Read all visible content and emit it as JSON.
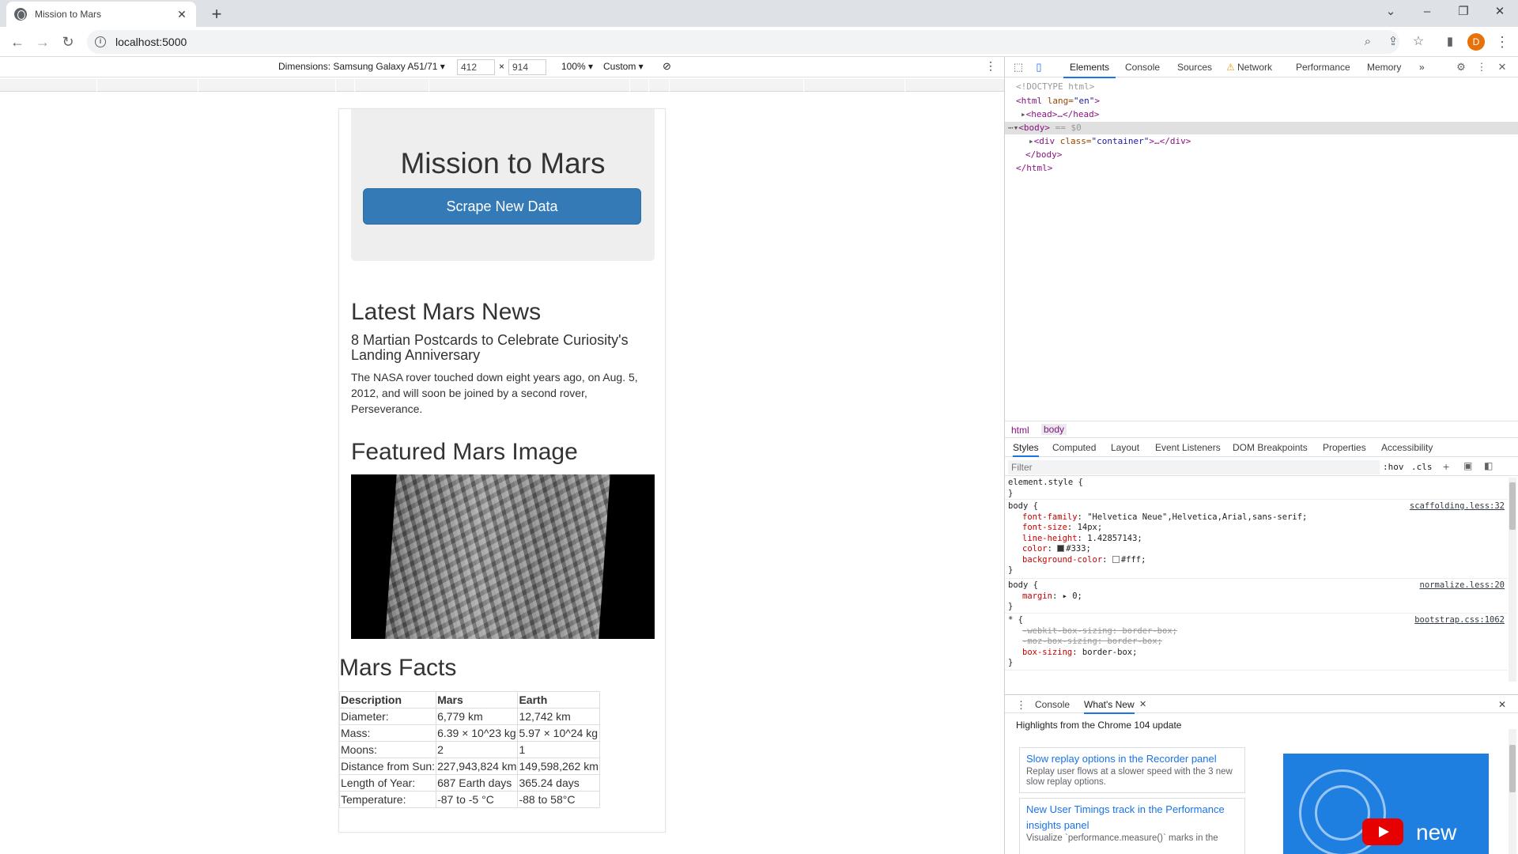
{
  "browser": {
    "tab_title": "Mission to Mars",
    "tab_close": "✕",
    "new_tab": "+",
    "url": "localhost:5000",
    "avatar_initial": "D"
  },
  "device_toolbar": {
    "dimensions_label": "Dimensions: Samsung Galaxy A51/71 ▾",
    "width": "412",
    "times": "×",
    "height": "914",
    "zoom": "100% ▾",
    "throttle": "Custom ▾"
  },
  "page": {
    "title": "Mission to Mars",
    "scrape_button": "Scrape New Data",
    "news_heading": "Latest Mars News",
    "news_title": "8 Martian Postcards to Celebrate Curiosity's Landing Anniversary",
    "news_paragraph": "The NASA rover touched down eight years ago, on Aug. 5, 2012, and will soon be joined by a second rover, Perseverance.",
    "image_heading": "Featured Mars Image",
    "facts_heading": "Mars Facts",
    "facts_table": {
      "headers": [
        "Description",
        "Mars",
        "Earth"
      ],
      "rows": [
        [
          "Diameter:",
          "6,779 km",
          "12,742 km"
        ],
        [
          "Mass:",
          "6.39 × 10^23 kg",
          "5.97 × 10^24 kg"
        ],
        [
          "Moons:",
          "2",
          "1"
        ],
        [
          "Distance from Sun:",
          "227,943,824 km",
          "149,598,262 km"
        ],
        [
          "Length of Year:",
          "687 Earth days",
          "365.24 days"
        ],
        [
          "Temperature:",
          "-87 to -5 °C",
          "-88 to 58°C"
        ]
      ]
    }
  },
  "devtools": {
    "tabs": [
      "Elements",
      "Console",
      "Sources",
      "Network",
      "Performance",
      "Memory"
    ],
    "more_tabs": "»",
    "dom": {
      "doctype": "<!DOCTYPE html>",
      "html_open_tag": "<html",
      "html_attr": " lang=",
      "html_attr_val": "\"en\"",
      "html_close_bracket": ">",
      "head": "<head>…</head>",
      "body_open": "<body>",
      "body_marker": " == $0",
      "div_open": "<div",
      "div_attr": " class=",
      "div_attr_val": "\"container\"",
      "div_rest": ">…</div>",
      "body_close": "</body>",
      "html_close": "</html>"
    },
    "breadcrumbs": [
      "html",
      "body"
    ],
    "subtabs": [
      "Styles",
      "Computed",
      "Layout",
      "Event Listeners",
      "DOM Breakpoints",
      "Properties",
      "Accessibility"
    ],
    "filter_placeholder": "Filter",
    "filter_hov": ":hov",
    "filter_cls": ".cls",
    "styles": {
      "element_style": "element.style {",
      "close": "}",
      "rule1_selector": "body {",
      "rule1_source": "scaffolding.less:32",
      "rule1_props": [
        [
          "font-family",
          "\"Helvetica Neue\",Helvetica,Arial,sans-serif;"
        ],
        [
          "font-size",
          "14px;"
        ],
        [
          "line-height",
          "1.42857143;"
        ],
        [
          "color",
          "#333;"
        ],
        [
          "background-color",
          "#fff;"
        ]
      ],
      "rule2_selector": "body {",
      "rule2_source": "normalize.less:20",
      "rule2_prop": "margin",
      "rule2_val": "▸ 0;",
      "rule3_selector": "* {",
      "rule3_source": "bootstrap.css:1062",
      "rule3_strike1": "-webkit-box-sizing: border-box;",
      "rule3_strike2": "-moz-box-sizing: border-box;",
      "rule3_prop": "box-sizing",
      "rule3_val": "border-box;"
    },
    "drawer": {
      "console_tab": "Console",
      "whatsnew_tab": "What's New",
      "close_x": "✕",
      "heading": "Highlights from the Chrome 104 update",
      "cards": [
        {
          "title": "Slow replay options in the Recorder panel",
          "desc": "Replay user flows at a slower speed with the 3 new slow replay options."
        },
        {
          "title": "New User Timings track in the Performance insights panel",
          "desc": "Visualize `performance.measure()` marks in the"
        }
      ],
      "video_text": "new"
    }
  },
  "colors": {
    "button_primary": "#337ab7",
    "jumbotron_bg": "#eeeeee",
    "devtools_accent": "#1a73e8",
    "avatar": "#e8710a"
  }
}
